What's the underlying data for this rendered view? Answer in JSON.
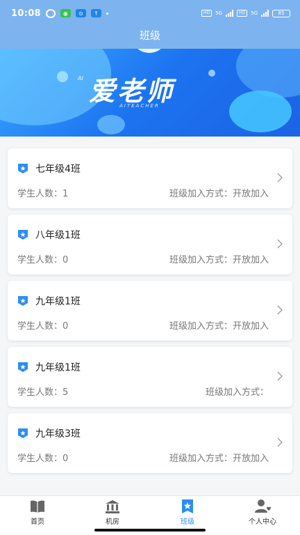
{
  "status_bar": {
    "time": "10:08",
    "net1": "5G",
    "net2": "5G",
    "hd1": "HD",
    "hd2": "HD",
    "battery": "85"
  },
  "header": {
    "title": "班级"
  },
  "banner": {
    "brand_small": "AI",
    "brand": "爱老师",
    "brand_sub": "AITEACHER"
  },
  "labels": {
    "student_count_label": "学生人数：",
    "join_method_label": "班级加入方式："
  },
  "classes": [
    {
      "name": "七年级4班",
      "students": "学生人数：1",
      "join": "班级加入方式：开放加入"
    },
    {
      "name": "八年级1班",
      "students": "学生人数：0",
      "join": "班级加入方式：开放加入"
    },
    {
      "name": "九年级1班",
      "students": "学生人数：0",
      "join": "班级加入方式：开放加入"
    },
    {
      "name": "九年级1班",
      "students": "学生人数：5",
      "join": "班级加入方式："
    },
    {
      "name": "九年级3班",
      "students": "学生人数：0",
      "join": "班级加入方式：开放加入"
    }
  ],
  "tabs": [
    {
      "label": "首页",
      "icon": "book-icon",
      "active": false
    },
    {
      "label": "机房",
      "icon": "building-icon",
      "active": false
    },
    {
      "label": "班级",
      "icon": "star-bookmark-icon",
      "active": true
    },
    {
      "label": "个人中心",
      "icon": "user-heart-icon",
      "active": false
    }
  ],
  "colors": {
    "header": "#7db3ef",
    "accent": "#2c8ef3",
    "badge": "#2c8ef3"
  }
}
